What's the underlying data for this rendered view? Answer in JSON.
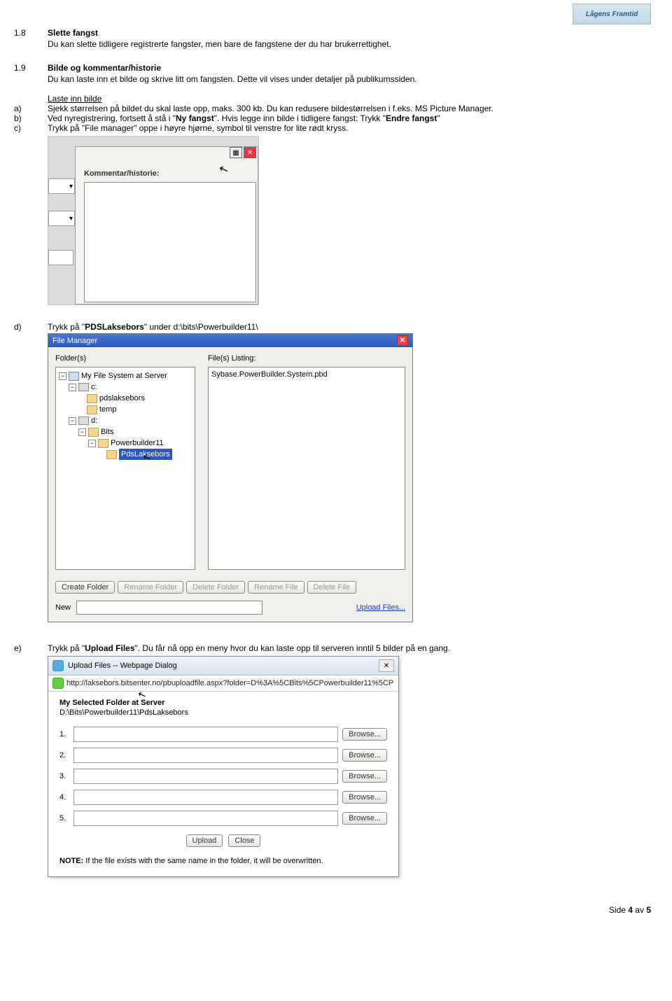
{
  "logo_text": "Lågens Framtid",
  "sections": [
    {
      "num": "1.8",
      "title": "Slette fangst",
      "text": "Du kan slette tidligere registrerte fangster, men bare de fangstene der du har brukerrettighet."
    },
    {
      "num": "1.9",
      "title": "Bilde og kommentar/historie",
      "text": "Du kan laste inn et bilde og skrive litt om fangsten. Dette vil vises under detaljer på publikumssiden."
    }
  ],
  "sub_heading": "Laste inn bilde",
  "steps": {
    "a": "Sjekk størrelsen på bildet du skal laste opp, maks. 300 kb. Du kan redusere bildestørrelsen i f.eks. MS Picture Manager.",
    "b_pre": "Ved nyregistrering, fortsett å stå i \"",
    "b_bold1": "Ny fangst",
    "b_mid": "\". Hvis legge inn bilde i tidligere fangst: Trykk \"",
    "b_bold2": "Endre fangst",
    "b_post": "\"",
    "c": "Trykk på \"File manager\" oppe i høyre hjørne, symbol til venstre for lite rødt kryss.",
    "d_pre": "Trykk på \"",
    "d_bold": "PDSLaksebors",
    "d_post": "\"  under d:\\bits\\Powerbuilder11\\",
    "e_pre": "Trykk på \"",
    "e_bold": "Upload Files",
    "e_post": "\". Du får nå opp en meny hvor du kan laste opp til serveren inntil 5 bilder på en gang."
  },
  "shot1": {
    "panel_label": "Kommentar/historie:"
  },
  "filemanager": {
    "title": "File Manager",
    "folders_label": "Folder(s)",
    "files_label": "File(s) Listing:",
    "tree": {
      "root": "My File System at Server",
      "c": "c:",
      "c1": "pdslaksebors",
      "c2": "temp",
      "d": "d:",
      "d1": "Bits",
      "d2": "Powerbuilder11",
      "d3": "PdsLaksebors"
    },
    "file1": "Sybase.PowerBuilder.System.pbd",
    "buttons": {
      "create": "Create Folder",
      "rename_folder": "Rename Folder",
      "delete_folder": "Delete Folder",
      "rename_file": "Rename File",
      "delete_file": "Delete File"
    },
    "new_label": "New",
    "upload_link": "Upload Files..."
  },
  "upload": {
    "title": "Upload Files -- Webpage Dialog",
    "url": "http://laksebors.bitsenter.no/pbuploadfile.aspx?folder=D%3A%5CBits%5CPowerbuilder11%5CP",
    "heading": "My Selected Folder at Server",
    "path": "D:\\Bits\\Powerbuilder11\\PdsLaksebors",
    "rows": [
      "1.",
      "2.",
      "3.",
      "4.",
      "5."
    ],
    "browse": "Browse...",
    "upload_btn": "Upload",
    "close_btn": "Close",
    "note_b": "NOTE:",
    "note": " If the file exists with the same name in the folder, it will be overwritten."
  },
  "footer": {
    "text_pre": "Side ",
    "page": "4",
    "text_mid": " av ",
    "total": "5"
  }
}
